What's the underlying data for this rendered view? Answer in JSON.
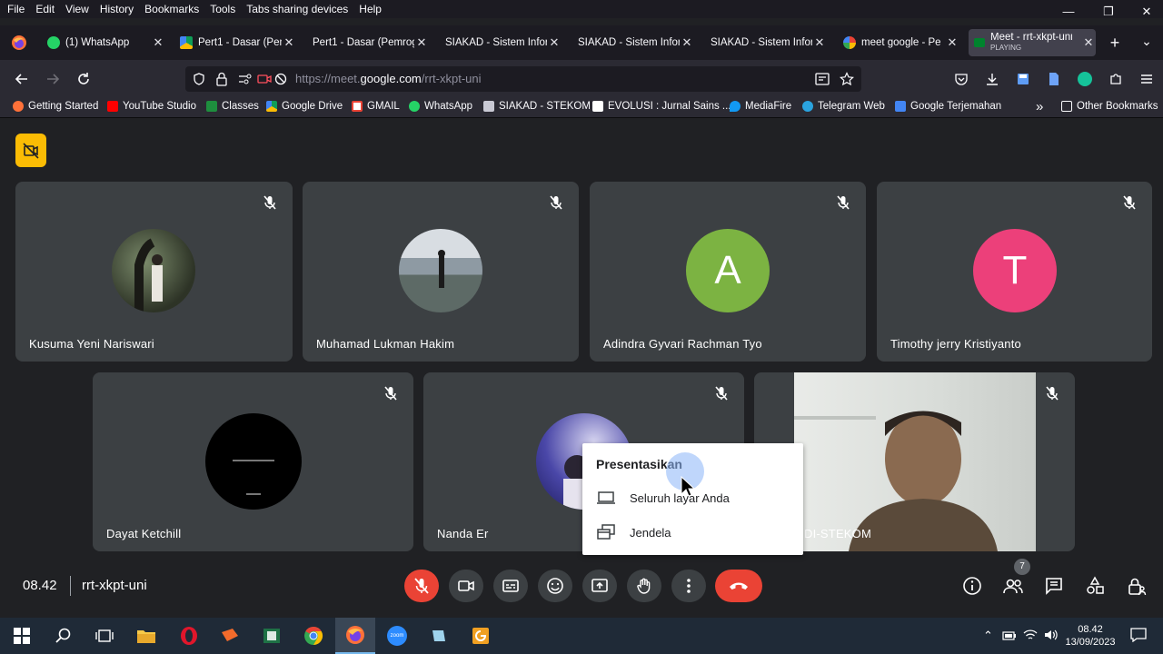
{
  "menu": [
    "File",
    "Edit",
    "View",
    "History",
    "Bookmarks",
    "Tools",
    "Tabs sharing devices",
    "Help"
  ],
  "window_controls": {
    "minimize": "—",
    "restore": "❐",
    "close": "✕"
  },
  "tabs": [
    {
      "label": "(1) WhatsApp",
      "icon": "whatsapp-icon"
    },
    {
      "label": "Pert1 - Dasar (Pem",
      "icon": "google-drive-icon"
    },
    {
      "label": "Pert1 - Dasar (Pemrog",
      "icon": "none"
    },
    {
      "label": "SIAKAD - Sistem Inform",
      "icon": "none"
    },
    {
      "label": "SIAKAD - Sistem Inform",
      "icon": "none"
    },
    {
      "label": "SIAKAD - Sistem Inform",
      "icon": "none"
    },
    {
      "label": "meet google - Pe",
      "icon": "google-icon"
    },
    {
      "label": "Meet - rrt-xkpt-uni",
      "sublabel": "PLAYING",
      "icon": "meet-icon",
      "active": true
    }
  ],
  "new_tab_symbol": "+",
  "tab_list_symbol": "⌄",
  "url": {
    "prefix": "https://meet.",
    "domain": "google.com",
    "path": "/rrt-xkpt-uni"
  },
  "bookmarks": [
    "Getting Started",
    "YouTube Studio",
    "Classes",
    "Google Drive",
    "GMAIL",
    "WhatsApp",
    "SIAKAD - STEKOM",
    "EVOLUSI : Jurnal Sains ...",
    "MediaFire",
    "Telegram Web",
    "Google Terjemahan"
  ],
  "bookmarks_overflow": "»",
  "other_bookmarks": "Other Bookmarks",
  "participants": [
    {
      "name": "Kusuma Yeni Nariswari",
      "avatar": "photo-tree",
      "muted": true
    },
    {
      "name": "Muhamad Lukman Hakim",
      "avatar": "photo-beach",
      "muted": true
    },
    {
      "name": "Adindra Gyvari Rachman Tyo",
      "avatar_letter": "A",
      "avatar_color": "#7cb342",
      "muted": true
    },
    {
      "name": "Timothy jerry Kristiyanto",
      "avatar_letter": "T",
      "avatar_color": "#ec407a",
      "muted": true
    },
    {
      "name": "Dayat Ketchill",
      "avatar": "photo-black",
      "muted": true
    },
    {
      "name": "Nanda Er",
      "avatar": "photo-moon",
      "muted": true
    },
    {
      "name": "DI-STEKOM",
      "avatar": "video-feed",
      "muted": true
    }
  ],
  "popup": {
    "title": "Presentasikan",
    "options": [
      {
        "label": "Seluruh layar Anda",
        "icon": "laptop-icon"
      },
      {
        "label": "Jendela",
        "icon": "window-icon"
      }
    ]
  },
  "meeting": {
    "time": "08.42",
    "code": "rrt-xkpt-uni",
    "people_count": "7"
  },
  "taskbar": {
    "time": "08.42",
    "date": "13/09/2023"
  },
  "colors": {
    "meet_bg": "#202124",
    "tile_bg": "#3c4043",
    "end_call": "#ea4335",
    "accent": "#8ab4f8"
  }
}
